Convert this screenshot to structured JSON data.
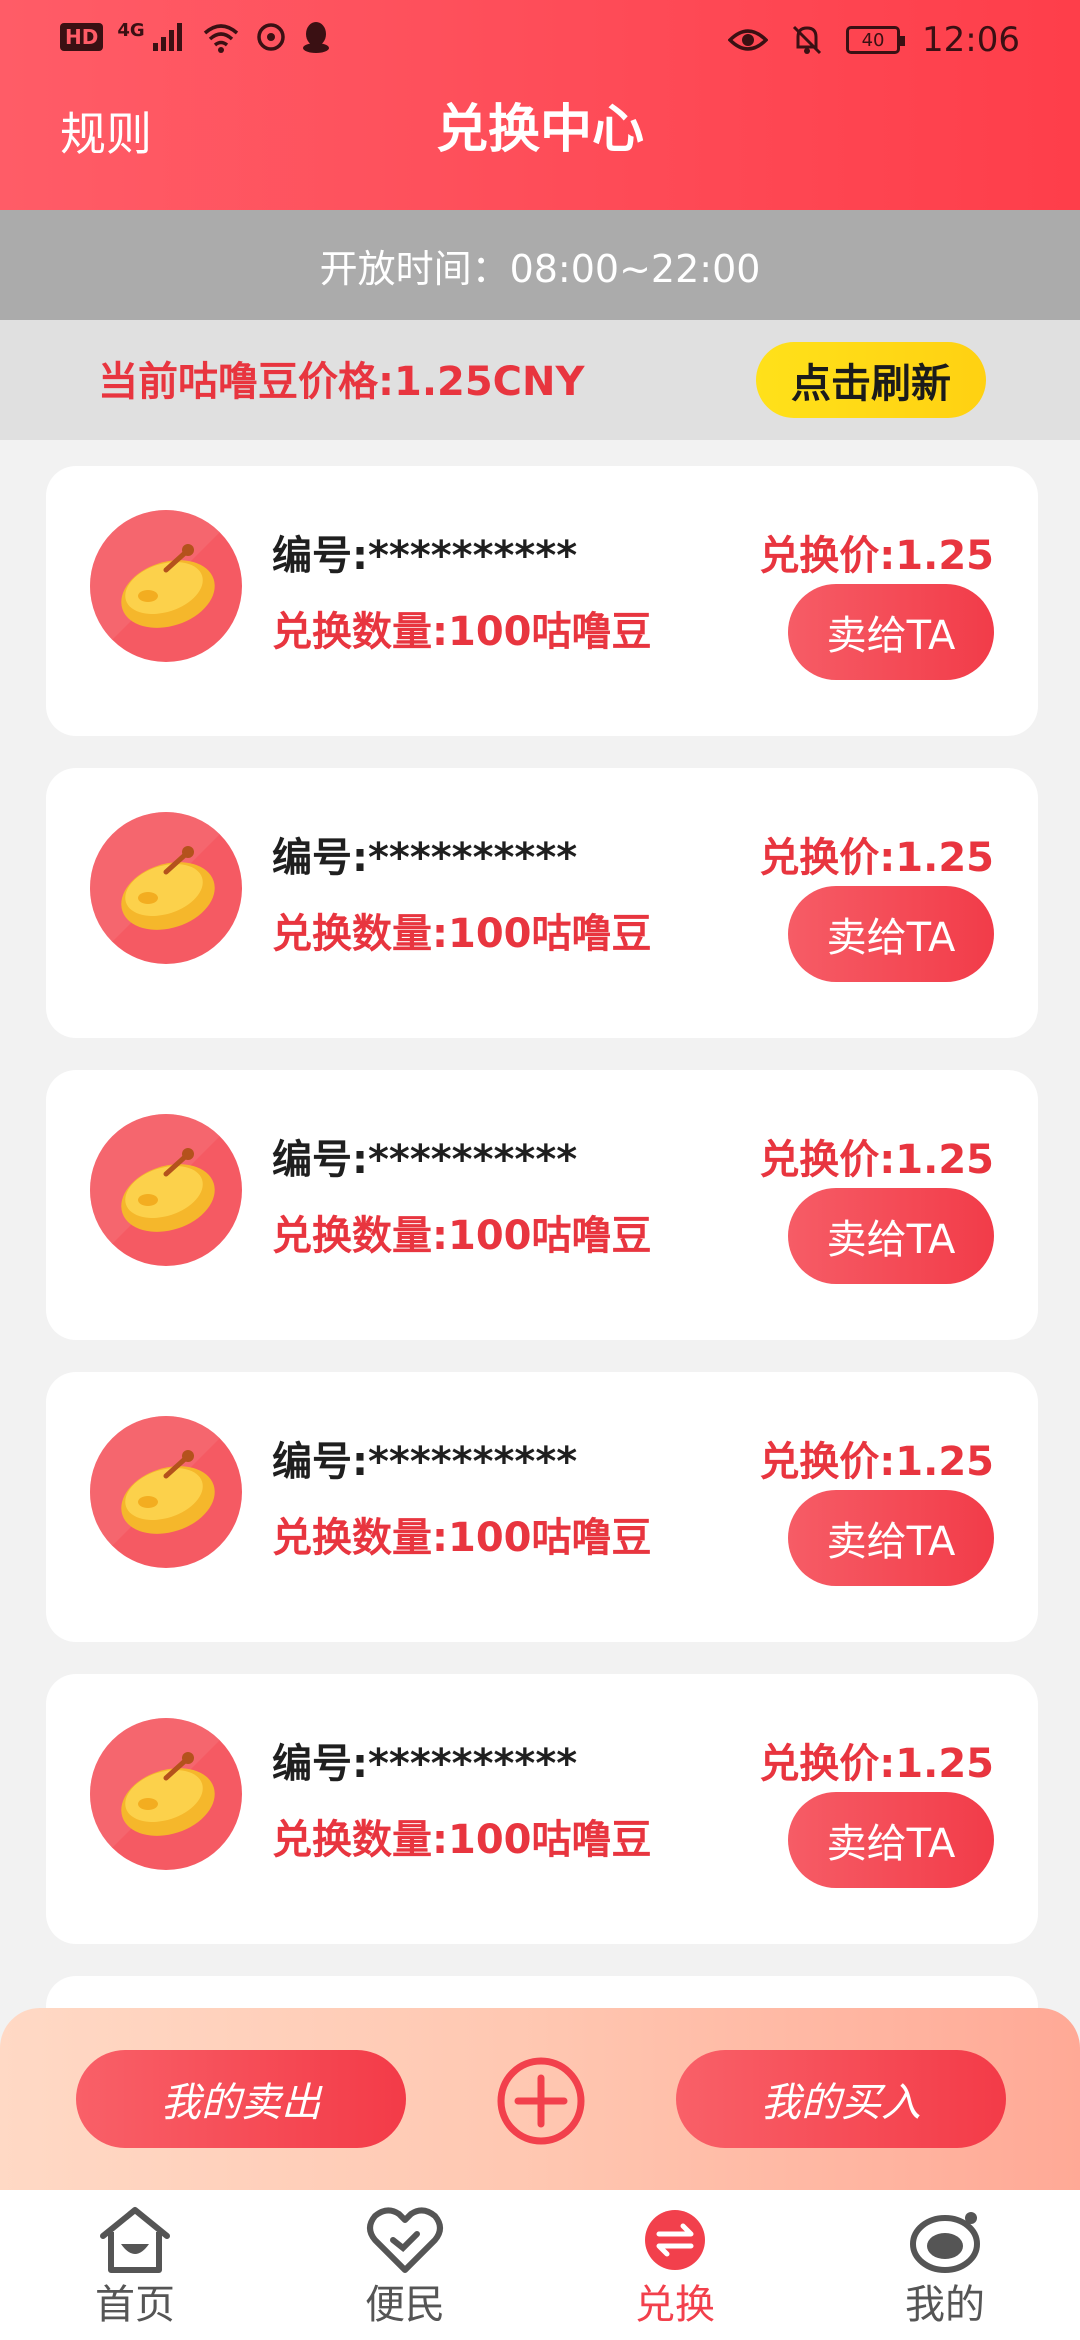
{
  "status_bar": {
    "left_badges": [
      "HD",
      "4G"
    ],
    "battery": "40",
    "time": "12:06"
  },
  "header": {
    "title": "兑换中心",
    "rules_label": "规则"
  },
  "open_time": "开放时间：08:00~22:00",
  "price_bar": {
    "price_text": "当前咕噜豆价格:1.25CNY",
    "refresh_label": "点击刷新"
  },
  "listings": [
    {
      "id_text": "编号:**********",
      "quantity_text": "兑换数量:100咕噜豆",
      "price_text": "兑换价:1.25",
      "sell_label": "卖给TA"
    },
    {
      "id_text": "编号:**********",
      "quantity_text": "兑换数量:100咕噜豆",
      "price_text": "兑换价:1.25",
      "sell_label": "卖给TA"
    },
    {
      "id_text": "编号:**********",
      "quantity_text": "兑换数量:100咕噜豆",
      "price_text": "兑换价:1.25",
      "sell_label": "卖给TA"
    },
    {
      "id_text": "编号:**********",
      "quantity_text": "兑换数量:100咕噜豆",
      "price_text": "兑换价:1.25",
      "sell_label": "卖给TA"
    },
    {
      "id_text": "编号:**********",
      "quantity_text": "兑换数量:100咕噜豆",
      "price_text": "兑换价:1.25",
      "sell_label": "卖给TA"
    }
  ],
  "action_bar": {
    "my_sales_label": "我的卖出",
    "my_purchases_label": "我的买入"
  },
  "tabs": [
    {
      "label": "首页",
      "icon": "home-icon",
      "active": false
    },
    {
      "label": "便民",
      "icon": "heart-icon",
      "active": false
    },
    {
      "label": "兑换",
      "icon": "exchange-icon",
      "active": true
    },
    {
      "label": "我的",
      "icon": "profile-icon",
      "active": false
    }
  ],
  "colors": {
    "brand_red": "#fe4a56",
    "price_red": "#e8353f",
    "refresh_yellow": "#ffd112",
    "tab_active": "#f2404c"
  }
}
